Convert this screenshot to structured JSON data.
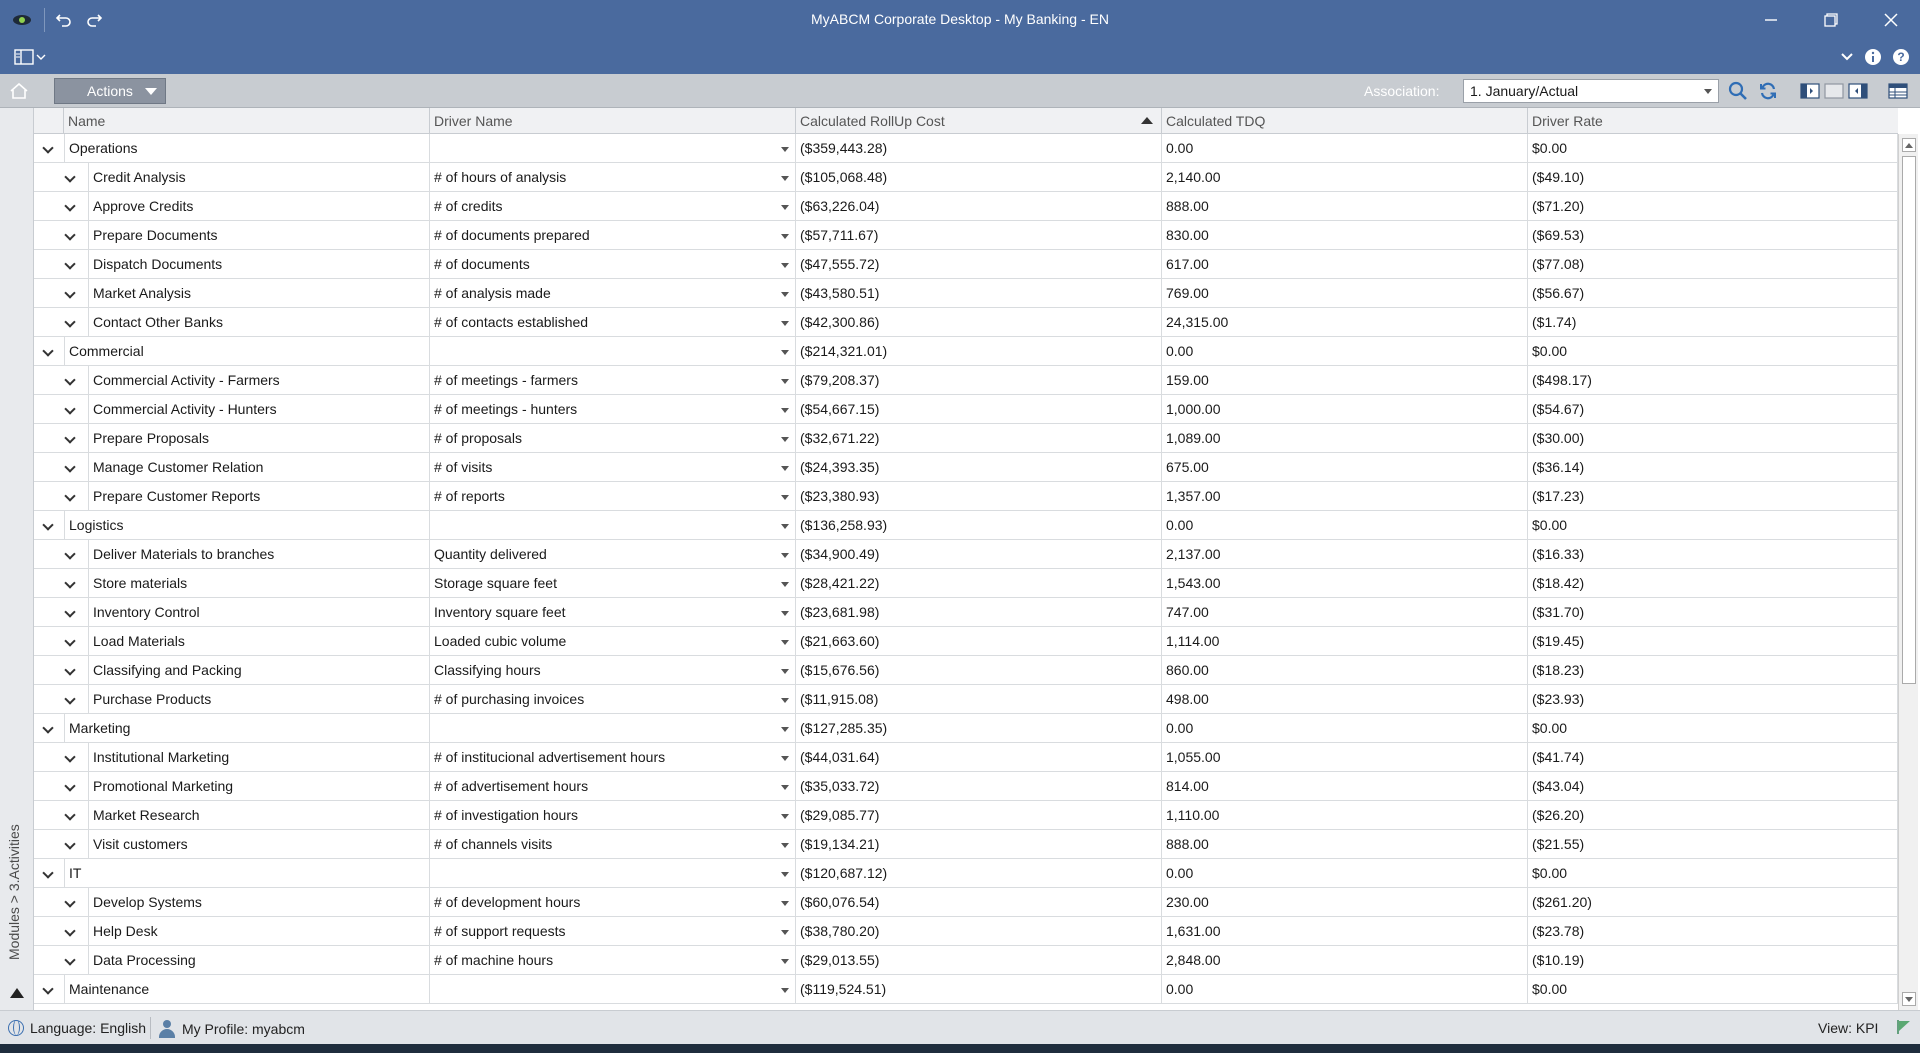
{
  "window": {
    "title": "MyABCM Corporate Desktop - My Banking - EN",
    "icons": [
      "app-logo-icon",
      "undo-icon",
      "redo-icon",
      "minimize-icon",
      "restore-icon",
      "close-icon"
    ]
  },
  "ribbon": {
    "icons": [
      "panel-toggle-icon",
      "chevron-down-icon",
      "info-icon",
      "help-icon"
    ]
  },
  "toolbar": {
    "actions_label": "Actions",
    "association_label": "Association:",
    "association_value": "1. January/Actual"
  },
  "leftbar": {
    "breadcrumb": "Modules > 3.Activities"
  },
  "grid": {
    "columns": [
      "Name",
      "Driver Name",
      "Calculated RollUp Cost",
      "Calculated TDQ",
      "Driver Rate"
    ],
    "sorted_column": "Calculated RollUp Cost",
    "sort_direction": "ascending",
    "rows": [
      {
        "level": 0,
        "name": "Operations",
        "driver": "",
        "cost": "($359,443.28)",
        "tdq": "0.00",
        "rate": "$0.00"
      },
      {
        "level": 1,
        "name": "Credit Analysis",
        "driver": "# of hours of analysis",
        "cost": "($105,068.48)",
        "tdq": "2,140.00",
        "rate": "($49.10)"
      },
      {
        "level": 1,
        "name": "Approve Credits",
        "driver": "# of credits",
        "cost": "($63,226.04)",
        "tdq": "888.00",
        "rate": "($71.20)"
      },
      {
        "level": 1,
        "name": "Prepare Documents",
        "driver": "# of documents prepared",
        "cost": "($57,711.67)",
        "tdq": "830.00",
        "rate": "($69.53)"
      },
      {
        "level": 1,
        "name": "Dispatch Documents",
        "driver": "# of documents",
        "cost": "($47,555.72)",
        "tdq": "617.00",
        "rate": "($77.08)"
      },
      {
        "level": 1,
        "name": "Market Analysis",
        "driver": "# of analysis made",
        "cost": "($43,580.51)",
        "tdq": "769.00",
        "rate": "($56.67)"
      },
      {
        "level": 1,
        "name": "Contact Other Banks",
        "driver": "# of contacts established",
        "cost": "($42,300.86)",
        "tdq": "24,315.00",
        "rate": "($1.74)"
      },
      {
        "level": 0,
        "name": "Commercial",
        "driver": "",
        "cost": "($214,321.01)",
        "tdq": "0.00",
        "rate": "$0.00"
      },
      {
        "level": 1,
        "name": "Commercial Activity - Farmers",
        "driver": "# of meetings - farmers",
        "cost": "($79,208.37)",
        "tdq": "159.00",
        "rate": "($498.17)"
      },
      {
        "level": 1,
        "name": "Commercial Activity - Hunters",
        "driver": "# of meetings - hunters",
        "cost": "($54,667.15)",
        "tdq": "1,000.00",
        "rate": "($54.67)"
      },
      {
        "level": 1,
        "name": "Prepare Proposals",
        "driver": "# of proposals",
        "cost": "($32,671.22)",
        "tdq": "1,089.00",
        "rate": "($30.00)"
      },
      {
        "level": 1,
        "name": "Manage Customer Relation",
        "driver": "# of visits",
        "cost": "($24,393.35)",
        "tdq": "675.00",
        "rate": "($36.14)"
      },
      {
        "level": 1,
        "name": "Prepare Customer Reports",
        "driver": "# of reports",
        "cost": "($23,380.93)",
        "tdq": "1,357.00",
        "rate": "($17.23)"
      },
      {
        "level": 0,
        "name": "Logistics",
        "driver": "",
        "cost": "($136,258.93)",
        "tdq": "0.00",
        "rate": "$0.00"
      },
      {
        "level": 1,
        "name": "Deliver Materials to branches",
        "driver": "Quantity delivered",
        "cost": "($34,900.49)",
        "tdq": "2,137.00",
        "rate": "($16.33)"
      },
      {
        "level": 1,
        "name": "Store materials",
        "driver": "Storage square feet",
        "cost": "($28,421.22)",
        "tdq": "1,543.00",
        "rate": "($18.42)"
      },
      {
        "level": 1,
        "name": "Inventory Control",
        "driver": "Inventory square feet",
        "cost": "($23,681.98)",
        "tdq": "747.00",
        "rate": "($31.70)"
      },
      {
        "level": 1,
        "name": "Load Materials",
        "driver": "Loaded cubic volume",
        "cost": "($21,663.60)",
        "tdq": "1,114.00",
        "rate": "($19.45)"
      },
      {
        "level": 1,
        "name": "Classifying and Packing",
        "driver": "Classifying hours",
        "cost": "($15,676.56)",
        "tdq": "860.00",
        "rate": "($18.23)"
      },
      {
        "level": 1,
        "name": "Purchase Products",
        "driver": "# of purchasing invoices",
        "cost": "($11,915.08)",
        "tdq": "498.00",
        "rate": "($23.93)"
      },
      {
        "level": 0,
        "name": "Marketing",
        "driver": "",
        "cost": "($127,285.35)",
        "tdq": "0.00",
        "rate": "$0.00"
      },
      {
        "level": 1,
        "name": "Institutional Marketing",
        "driver": "# of institucional advertisement hours",
        "cost": "($44,031.64)",
        "tdq": "1,055.00",
        "rate": "($41.74)"
      },
      {
        "level": 1,
        "name": "Promotional Marketing",
        "driver": "# of advertisement hours",
        "cost": "($35,033.72)",
        "tdq": "814.00",
        "rate": "($43.04)"
      },
      {
        "level": 1,
        "name": "Market Research",
        "driver": "# of investigation hours",
        "cost": "($29,085.77)",
        "tdq": "1,110.00",
        "rate": "($26.20)"
      },
      {
        "level": 1,
        "name": "Visit customers",
        "driver": "# of channels visits",
        "cost": "($19,134.21)",
        "tdq": "888.00",
        "rate": "($21.55)"
      },
      {
        "level": 0,
        "name": "IT",
        "driver": "",
        "cost": "($120,687.12)",
        "tdq": "0.00",
        "rate": "$0.00"
      },
      {
        "level": 1,
        "name": "Develop Systems",
        "driver": "# of development hours",
        "cost": "($60,076.54)",
        "tdq": "230.00",
        "rate": "($261.20)"
      },
      {
        "level": 1,
        "name": "Help Desk",
        "driver": "# of support requests",
        "cost": "($38,780.20)",
        "tdq": "1,631.00",
        "rate": "($23.78)"
      },
      {
        "level": 1,
        "name": "Data Processing",
        "driver": "# of machine hours",
        "cost": "($29,013.55)",
        "tdq": "2,848.00",
        "rate": "($10.19)"
      },
      {
        "level": 0,
        "name": "Maintenance",
        "driver": "",
        "cost": "($119,524.51)",
        "tdq": "0.00",
        "rate": "$0.00"
      }
    ]
  },
  "statusbar": {
    "language": "Language: English",
    "profile": "My Profile: myabcm",
    "view": "View: KPI"
  },
  "colors": {
    "titlebar": "#4a6a9e",
    "toolbar": "#c8ccd1",
    "accent_icon": "#2f6db5"
  }
}
